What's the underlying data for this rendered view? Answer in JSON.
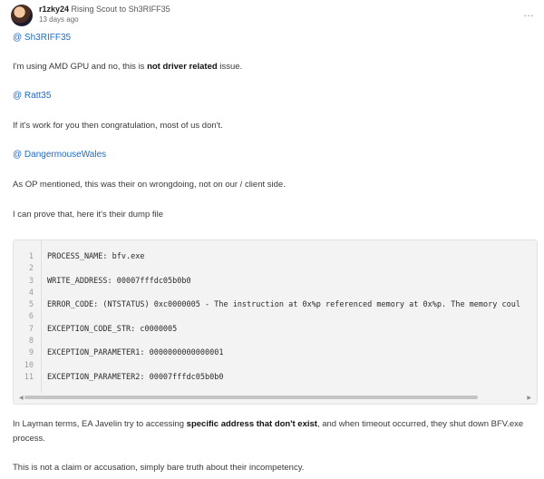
{
  "header": {
    "username": "r1zky24",
    "rank": "Rising Scout",
    "to_label": "to",
    "reply_to": "Sh3RIFF35",
    "time": "13 days ago",
    "more_icon": "…"
  },
  "mentions": {
    "m1": "@ Sh3RIFF35",
    "m2": "@ Ratt35",
    "m3": "@ DangermouseWales"
  },
  "paragraphs": {
    "p1_pre": "I'm using AMD GPU and no, this is ",
    "p1_bold": "not driver related",
    "p1_post": " issue.",
    "p2": "If it's work for you then congratulation, most of us don't.",
    "p3": "As OP mentioned, this was their on wrongdoing, not on our / client side.",
    "p4": "I can prove that, here it's their dump file",
    "p5_pre": "In Layman terms, EA Javelin try to accessing ",
    "p5_bold": "specific address that don't exist",
    "p5_post": ", and when timeout occurred, they shut down BFV.exe",
    "p5_line2": "process.",
    "p6": "This is not a claim or accusation, simply bare truth about their incompetency."
  },
  "code": {
    "lines": [
      {
        "n": "1",
        "text": "PROCESS_NAME:  bfv.exe"
      },
      {
        "n": "2",
        "text": ""
      },
      {
        "n": "3",
        "text": "WRITE_ADDRESS:  00007fffdc05b0b0"
      },
      {
        "n": "4",
        "text": ""
      },
      {
        "n": "5",
        "text": "ERROR_CODE: (NTSTATUS) 0xc0000005 - The instruction at 0x%p referenced memory at 0x%p. The memory coul"
      },
      {
        "n": "6",
        "text": ""
      },
      {
        "n": "7",
        "text": "EXCEPTION_CODE_STR:  c0000005"
      },
      {
        "n": "8",
        "text": ""
      },
      {
        "n": "9",
        "text": "EXCEPTION_PARAMETER1:  0000000000000001"
      },
      {
        "n": "10",
        "text": ""
      },
      {
        "n": "11",
        "text": "EXCEPTION_PARAMETER2:  00007fffdc05b0b0"
      }
    ],
    "scroll_left": "◀",
    "scroll_right": "▶"
  },
  "colors": {
    "link": "#1e6bc8",
    "code_bg": "#f3f3f4"
  }
}
